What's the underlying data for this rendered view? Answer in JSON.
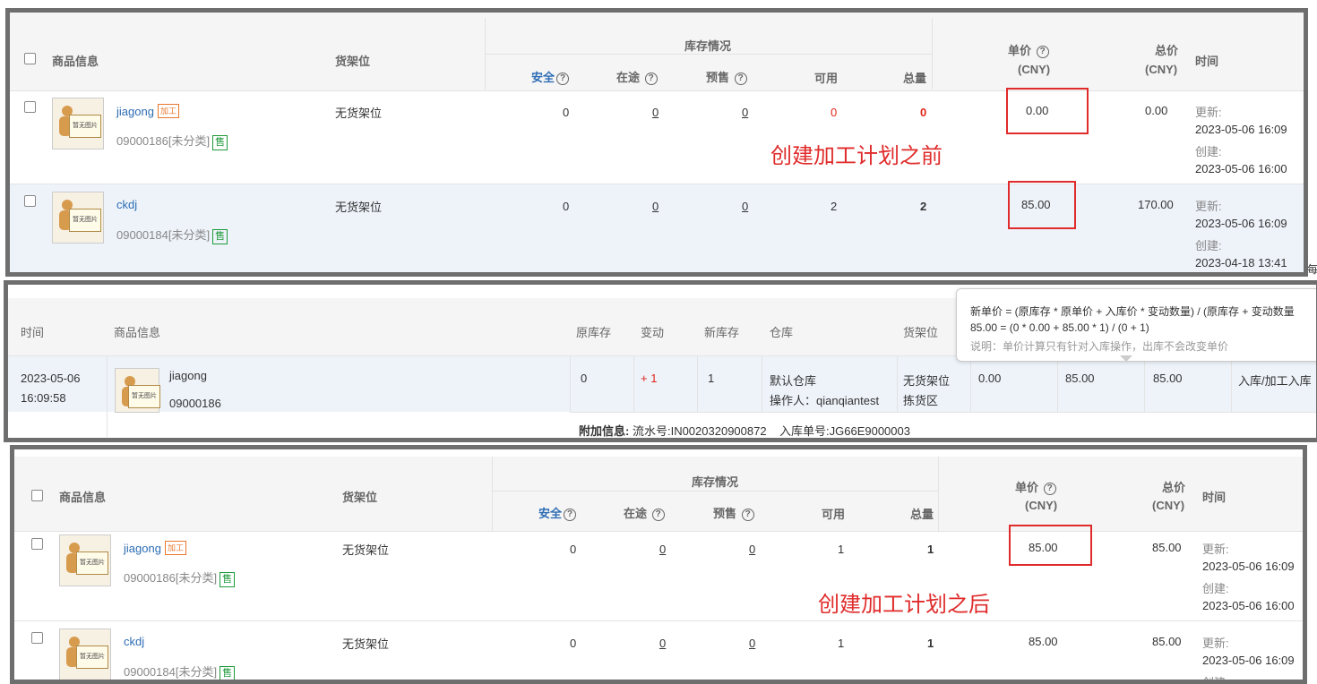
{
  "table_headers": {
    "product_info": "商品信息",
    "shelf": "货架位",
    "stock_status": "库存情况",
    "safe": "安全",
    "in_transit": "在途",
    "presale": "预售",
    "available": "可用",
    "total": "总量",
    "unit_price": "单价",
    "total_price": "总价",
    "currency": "(CNY)",
    "time": "时间"
  },
  "before": {
    "annotation": "创建加工计划之前",
    "rows": [
      {
        "name": "jiagong",
        "tag": "加工",
        "sku": "09000186[未分类]",
        "sale_tag": "售",
        "shelf": "无货架位",
        "safe": "0",
        "transit": "0",
        "presale": "0",
        "available": "0",
        "total": "0",
        "unit_price": "0.00",
        "total_price": "0.00",
        "updated_label": "更新:",
        "updated": "2023-05-06 16:09",
        "created_label": "创建:",
        "created": "2023-05-06 16:00"
      },
      {
        "name": "ckdj",
        "tag": "",
        "sku": "09000184[未分类]",
        "sale_tag": "售",
        "shelf": "无货架位",
        "safe": "0",
        "transit": "0",
        "presale": "0",
        "available": "2",
        "total": "2",
        "unit_price": "85.00",
        "total_price": "170.00",
        "updated_label": "更新:",
        "updated": "2023-05-06 16:09",
        "created_label": "创建:",
        "created": "2023-04-18 13:41"
      }
    ]
  },
  "middle": {
    "headers": {
      "time": "时间",
      "product_info": "商品信息",
      "orig_stock": "原库存",
      "change": "变动",
      "new_stock": "新库存",
      "warehouse": "仓库",
      "shelf": "货架位"
    },
    "tooltip": {
      "line1": "新单价 = (原库存 * 原单价 + 入库价 * 变动数量) / (原库存 + 变动数量",
      "line2": "85.00 = (0 * 0.00 + 85.00 * 1) / (0 + 1)",
      "line3": "说明：单价计算只有针对入库操作，出库不会改变单价"
    },
    "row": {
      "date": "2023-05-06",
      "time": "16:09:58",
      "name": "jiagong",
      "sku": "09000186",
      "orig_stock": "0",
      "change": "+ 1",
      "new_stock": "1",
      "warehouse": "默认仓库",
      "operator": "操作人：qianqiantest",
      "shelf1": "无货架位",
      "shelf2": "拣货区",
      "v1": "0.00",
      "v2": "85.00",
      "v3": "85.00",
      "type": "入库/加工入库"
    },
    "extra_label": "附加信息:",
    "extra_text": "流水号:IN0020320900872    入库单号:JG66E9000003"
  },
  "after": {
    "annotation": "创建加工计划之后",
    "rows": [
      {
        "name": "jiagong",
        "tag": "加工",
        "sku": "09000186[未分类]",
        "sale_tag": "售",
        "shelf": "无货架位",
        "safe": "0",
        "transit": "0",
        "presale": "0",
        "available": "1",
        "total": "1",
        "unit_price": "85.00",
        "total_price": "85.00",
        "updated_label": "更新:",
        "updated": "2023-05-06 16:09",
        "created_label": "创建:",
        "created": "2023-05-06 16:00"
      },
      {
        "name": "ckdj",
        "tag": "",
        "sku": "09000184[未分类]",
        "sale_tag": "售",
        "shelf": "无货架位",
        "safe": "0",
        "transit": "0",
        "presale": "0",
        "available": "1",
        "total": "1",
        "unit_price": "85.00",
        "total_price": "85.00",
        "updated_label": "更新:",
        "updated": "2023-05-06 16:09",
        "created_label": "创建:",
        "created": ""
      }
    ]
  },
  "no_image_text": "暂无图片",
  "background_fragments": {
    "edge_right": "每"
  }
}
